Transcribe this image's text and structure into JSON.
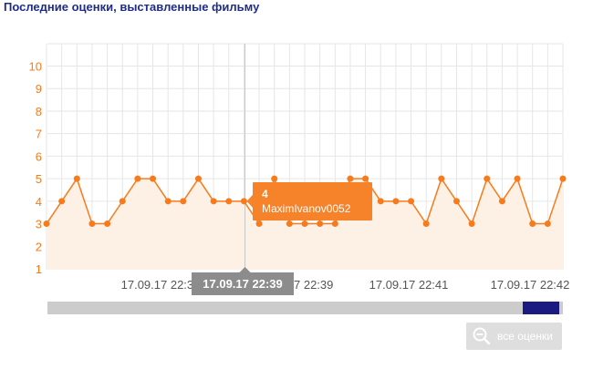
{
  "header": {
    "title": "Последние оценки, выставленные фильму"
  },
  "colors": {
    "accent": "#f77b1c",
    "area_fill": "#fdf0e4",
    "grid": "#e6e6e6",
    "tooltip_bg": "#f6822a",
    "crosshair_label_bg": "#8c8c8c",
    "navigator_handle": "#1a1a80",
    "navigator_track": "#cccccc"
  },
  "chart_data": {
    "type": "line",
    "y_ticks": [
      "1",
      "2",
      "3",
      "4",
      "5",
      "6",
      "7",
      "8",
      "9",
      "10"
    ],
    "ylim": [
      1,
      10.5
    ],
    "grid": true,
    "x_tick_labels": [
      "17.09.17 22:37",
      "17.09.17 22:39",
      "17.09.17 22:41",
      "17.09.17 22:42"
    ],
    "series": [
      {
        "values": [
          3,
          4,
          5,
          3,
          3,
          4,
          5,
          5,
          4,
          4,
          5,
          4,
          4,
          4,
          3,
          5,
          3,
          3,
          3,
          3,
          5,
          5,
          4,
          4,
          4,
          3,
          5,
          4,
          3,
          5,
          4,
          5,
          3,
          3,
          5
        ]
      }
    ],
    "tooltip": {
      "index": 13,
      "value": "4",
      "user": "MaximIvanov0052"
    },
    "crosshair_label": "17.09.17 22:39"
  },
  "navigator": {
    "icon": "magnify-minus-icon"
  },
  "zoom_button": {
    "label": "все оценки",
    "icon": "zoom-out-icon"
  }
}
